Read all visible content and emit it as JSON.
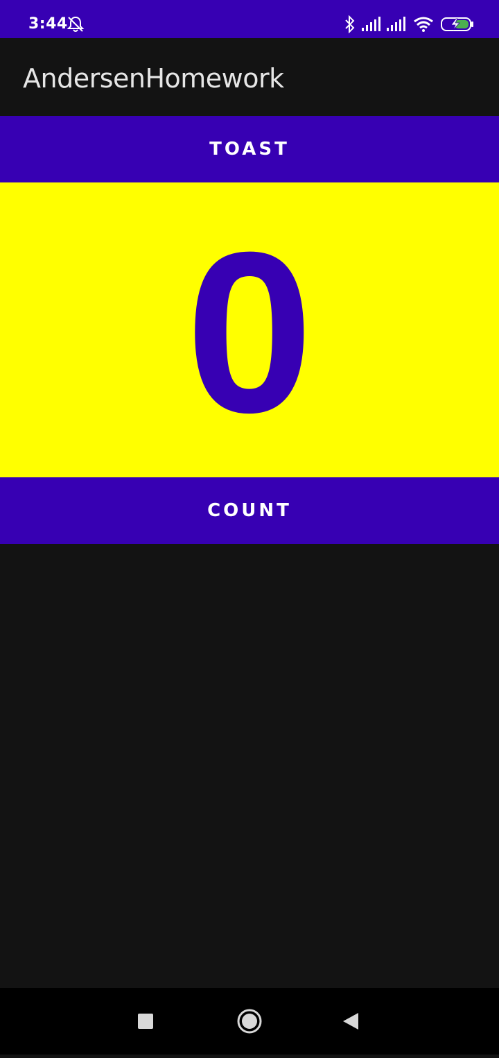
{
  "status_bar": {
    "time": "3:44",
    "icons": [
      "muted-bell-icon",
      "bluetooth-icon",
      "signal-icon",
      "signal-icon",
      "wifi-icon",
      "battery-charging-icon"
    ],
    "color": "#3700b3"
  },
  "app_bar": {
    "title": "AndersenHomework"
  },
  "buttons": {
    "toast_label": "TOAST",
    "count_label": "COUNT"
  },
  "counter": {
    "value": "0",
    "background": "#ffff00",
    "text_color": "#3700b3"
  },
  "nav_bar": {
    "buttons": [
      "recents-square-icon",
      "home-circle-icon",
      "back-triangle-icon"
    ]
  }
}
